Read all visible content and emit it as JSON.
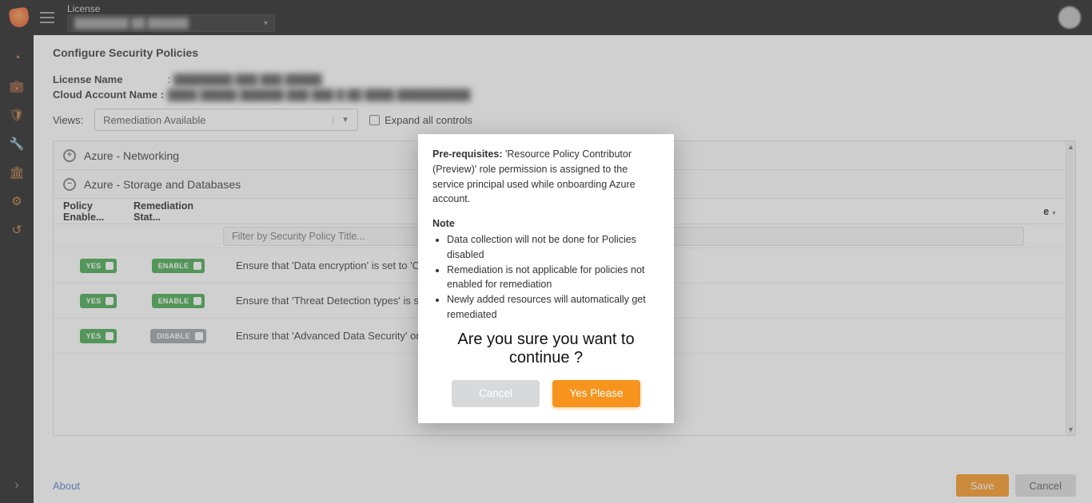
{
  "topbar": {
    "license_label": "License",
    "license_selected": "████████ ██ ██████",
    "chevron": "▾"
  },
  "rail": {
    "items": [
      "gauge-icon",
      "briefcase-icon",
      "shield-icon",
      "wrench-icon",
      "bank-icon",
      "gear-icon",
      "history-icon"
    ],
    "expand_glyph": "›"
  },
  "page": {
    "title": "Configure Security Policies",
    "license_name_label": "License Name",
    "license_name_value": "████████ ███ ███ █████",
    "cloud_account_label": "Cloud Account Name :",
    "cloud_account_value": "████ █████ ██████ ███ ███ █ ██ ████ ██████████",
    "views_label": "Views:",
    "views_value": "Remediation Available",
    "expand_all_label": "Expand all controls"
  },
  "groups": [
    {
      "name": "Azure - Networking",
      "expanded": false
    },
    {
      "name": "Azure - Storage and Databases",
      "expanded": true
    }
  ],
  "table": {
    "headers": {
      "policy_enabled": "Policy Enable...",
      "remediation_status": "Remediation Stat...",
      "end_sort": "e"
    },
    "filter_placeholder": "Filter by Security Policy Title...",
    "rows": [
      {
        "policy_pill": {
          "text": "YES",
          "color": "green"
        },
        "remediation_pill": {
          "text": "ENABLE",
          "color": "green"
        },
        "title": "Ensure that 'Data encryption' is set to 'On' for S"
      },
      {
        "policy_pill": {
          "text": "YES",
          "color": "green"
        },
        "remediation_pill": {
          "text": "ENABLE",
          "color": "green"
        },
        "title": "Ensure that 'Threat Detection types' is set to 'Al"
      },
      {
        "policy_pill": {
          "text": "YES",
          "color": "green"
        },
        "remediation_pill": {
          "text": "DISABLE",
          "color": "grey"
        },
        "title": "Ensure that 'Advanced Data Security' on a SQL s"
      }
    ]
  },
  "footer": {
    "about": "About",
    "save": "Save",
    "cancel": "Cancel"
  },
  "modal": {
    "prereq_label": "Pre-requisites:",
    "prereq_text": "'Resource Policy Contributor (Preview)' role permission is assigned to the service principal used while onboarding Azure account.",
    "note_label": "Note",
    "notes": [
      "Data collection will not be done for Policies disabled",
      "Remediation is not applicable for policies not enabled for remediation",
      "Newly added resources will automatically get remediated"
    ],
    "confirm": "Are you sure you want to continue ?",
    "cancel": "Cancel",
    "yes": "Yes Please"
  },
  "icons": {
    "gauge-icon": "◔",
    "briefcase-icon": "💼",
    "shield-icon": "🛡",
    "wrench-icon": "🔧",
    "bank-icon": "🏛",
    "gear-icon": "⚙",
    "history-icon": "↺"
  }
}
